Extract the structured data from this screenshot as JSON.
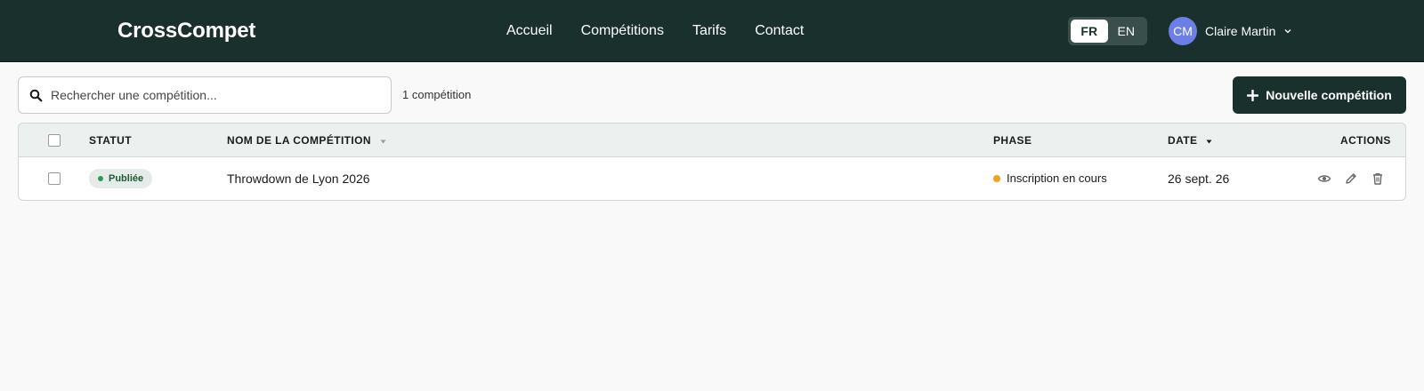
{
  "app": {
    "logo": "CrossCompet"
  },
  "nav": {
    "links": [
      "Accueil",
      "Compétitions",
      "Tarifs",
      "Contact"
    ]
  },
  "language": {
    "options": [
      "FR",
      "EN"
    ],
    "active": "FR"
  },
  "user": {
    "initials": "CM",
    "name": "Claire Martin"
  },
  "toolbar": {
    "search_placeholder": "Rechercher une compétition...",
    "count_label": "1 compétition",
    "new_button": "Nouvelle compétition"
  },
  "table": {
    "columns": {
      "status": "STATUT",
      "name": "NOM DE LA COMPÉTITION",
      "phase": "PHASE",
      "date": "DATE",
      "actions": "ACTIONS"
    },
    "rows": [
      {
        "status": "Publiée",
        "name": "Throwdown de Lyon 2026",
        "phase": "Inscription en cours",
        "date": "26 sept. 26"
      }
    ]
  },
  "colors": {
    "brand": "#19302c",
    "avatar": "#6b7fe6",
    "published": "#2e9a56",
    "phase_open": "#f0a21c"
  },
  "icons": [
    "search-icon",
    "plus-icon",
    "chevron-down-icon",
    "sort-icon",
    "eye-icon",
    "pencil-icon",
    "trash-icon"
  ]
}
